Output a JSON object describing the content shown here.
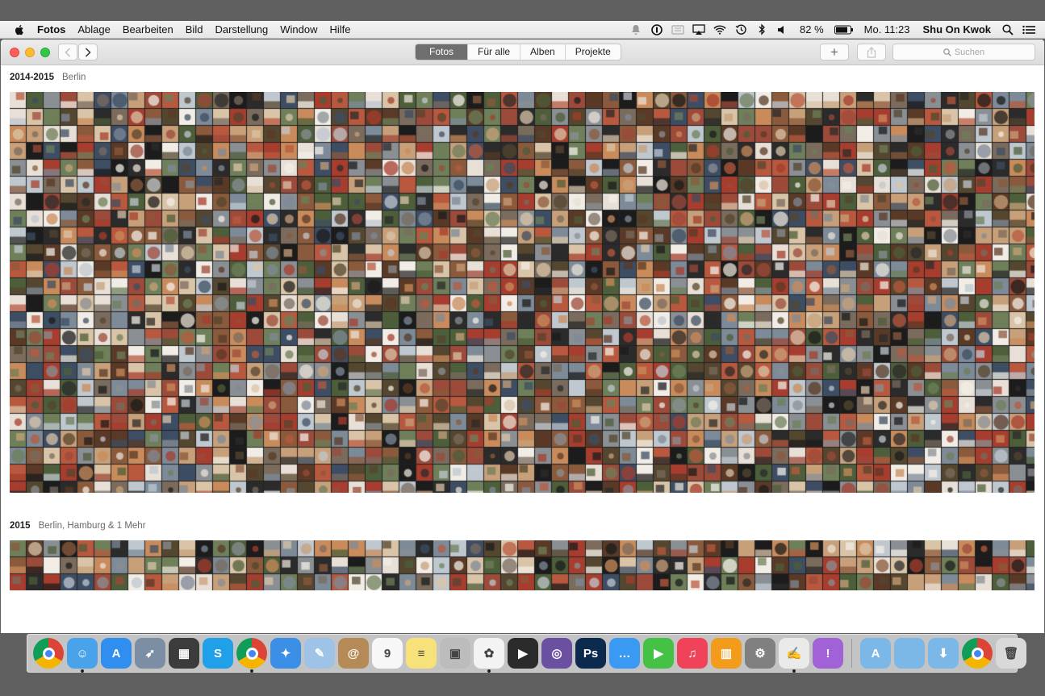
{
  "menubar": {
    "app_menu": "Fotos",
    "items": [
      "Ablage",
      "Bearbeiten",
      "Bild",
      "Darstellung",
      "Window",
      "Hilfe"
    ],
    "battery": "82 %",
    "clock": "Mo. 11:23",
    "user": "Shu On Kwok",
    "status_icons": [
      "notification-icon",
      "onepassword-icon",
      "flux-icon",
      "airplay-icon",
      "wifi-icon",
      "time-machine-icon",
      "bluetooth-icon",
      "volume-icon",
      "battery-icon",
      "spotlight-icon",
      "notification-center-icon"
    ]
  },
  "toolbar": {
    "tabs": [
      "Fotos",
      "Für alle",
      "Alben",
      "Projekte"
    ],
    "active_tab": "Fotos",
    "add_label": "+",
    "search_placeholder": "Suchen"
  },
  "sections": [
    {
      "year": "2014-2015",
      "location": "Berlin"
    },
    {
      "year": "2015",
      "location": "Berlin, Hamburg & 1 Mehr"
    }
  ],
  "dock": {
    "apps": [
      {
        "name": "chrome-app-icon",
        "color": "#e0e0e0",
        "glyph": "",
        "running": false
      },
      {
        "name": "finder-icon",
        "color": "#4aa3ea",
        "glyph": "☺",
        "running": true
      },
      {
        "name": "app-store-icon",
        "color": "#2f8ef0",
        "glyph": "A",
        "running": false
      },
      {
        "name": "launchpad-icon",
        "color": "#7c8ea3",
        "glyph": "➶",
        "running": false
      },
      {
        "name": "mission-control-icon",
        "color": "#3c3c3c",
        "glyph": "▦",
        "running": false
      },
      {
        "name": "skype-icon",
        "color": "#1fa0e8",
        "glyph": "S",
        "running": false
      },
      {
        "name": "chrome-icon",
        "color": "#e8e8e8",
        "glyph": "",
        "running": true
      },
      {
        "name": "safari-icon",
        "color": "#3b8fe6",
        "glyph": "✦",
        "running": false
      },
      {
        "name": "preview-icon",
        "color": "#9ec3e6",
        "glyph": "✎",
        "running": false
      },
      {
        "name": "contacts-icon",
        "color": "#b58a56",
        "glyph": "@",
        "running": false
      },
      {
        "name": "calendar-icon",
        "color": "#f7f7f7",
        "glyph": "9",
        "running": false
      },
      {
        "name": "notes-icon",
        "color": "#f7e27a",
        "glyph": "≡",
        "running": false
      },
      {
        "name": "image-capture-icon",
        "color": "#bcbcbc",
        "glyph": "▣",
        "running": false
      },
      {
        "name": "photos-icon",
        "color": "#f3f3f3",
        "glyph": "✿",
        "running": true
      },
      {
        "name": "final-cut-icon",
        "color": "#2b2b2b",
        "glyph": "▶",
        "running": false
      },
      {
        "name": "motion-icon",
        "color": "#6b4fa0",
        "glyph": "◎",
        "running": false
      },
      {
        "name": "photoshop-icon",
        "color": "#0c2a4e",
        "glyph": "Ps",
        "running": false
      },
      {
        "name": "messages-icon",
        "color": "#3a9af3",
        "glyph": "…",
        "running": false
      },
      {
        "name": "facetime-icon",
        "color": "#45c145",
        "glyph": "▶",
        "running": false
      },
      {
        "name": "itunes-icon",
        "color": "#f0435a",
        "glyph": "♫",
        "running": false
      },
      {
        "name": "ibooks-icon",
        "color": "#f39c1c",
        "glyph": "▥",
        "running": false
      },
      {
        "name": "system-preferences-icon",
        "color": "#808080",
        "glyph": "⚙",
        "running": false
      },
      {
        "name": "textedit-icon",
        "color": "#eaeaea",
        "glyph": "✍",
        "running": true
      },
      {
        "name": "feedback-icon",
        "color": "#a162d8",
        "glyph": "!",
        "running": false
      }
    ],
    "folders": [
      {
        "name": "applications-folder-icon",
        "color": "#7bb8e8",
        "glyph": "A"
      },
      {
        "name": "documents-folder-icon",
        "color": "#7bb8e8",
        "glyph": ""
      },
      {
        "name": "downloads-folder-icon",
        "color": "#7bb8e8",
        "glyph": "⬇"
      },
      {
        "name": "chrome-document-icon",
        "color": "#f4f4f4",
        "glyph": ""
      },
      {
        "name": "trash-icon",
        "color": "#d9d9d9",
        "glyph": "🗑"
      }
    ]
  }
}
